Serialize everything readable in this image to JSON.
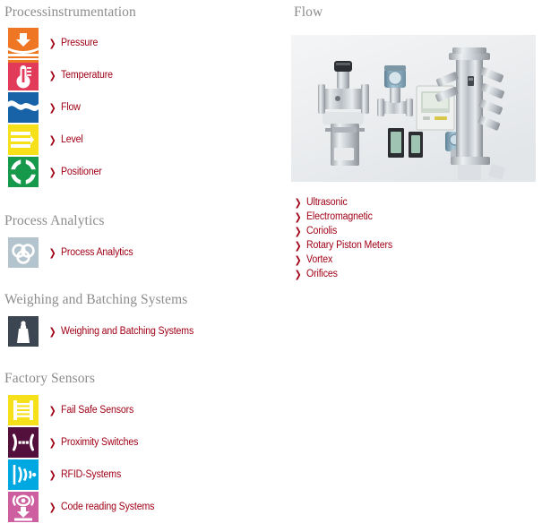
{
  "left_column": {
    "sections": [
      {
        "heading": "Processinstrumentation",
        "items": [
          {
            "label": "Pressure",
            "icon": "pressure-icon",
            "color": "#ef7622"
          },
          {
            "label": "Temperature",
            "icon": "temperature-icon",
            "color": "#e23b5a"
          },
          {
            "label": "Flow",
            "icon": "flow-icon",
            "color": "#1862a8"
          },
          {
            "label": "Level",
            "icon": "level-icon",
            "color": "#f5e01a"
          },
          {
            "label": "Positioner",
            "icon": "positioner-icon",
            "color": "#17994b"
          }
        ]
      },
      {
        "heading": "Process Analytics",
        "items": [
          {
            "label": "Process Analytics",
            "icon": "process-analytics-icon",
            "color": "#b4c4ce"
          }
        ]
      },
      {
        "heading": "Weighing and Batching Systems",
        "items": [
          {
            "label": "Weighing and Batching Systems",
            "icon": "weight-icon",
            "color": "#3c4652"
          }
        ]
      },
      {
        "heading": "Factory Sensors",
        "items": [
          {
            "label": "Fail Safe Sensors",
            "icon": "fail-safe-sensor-icon",
            "color": "#f5e01a"
          },
          {
            "label": "Proximity Switches",
            "icon": "proximity-switch-icon",
            "color": "#54103c"
          },
          {
            "label": "RFID-Systems",
            "icon": "rfid-icon",
            "color": "#00a8e1"
          },
          {
            "label": "Code reading Systems",
            "icon": "code-reading-icon",
            "color": "#cd5fa0"
          }
        ]
      }
    ]
  },
  "right_column": {
    "heading": "Flow",
    "image_alt": "flow-measurement-devices-photo",
    "links": [
      {
        "label": "Ultrasonic"
      },
      {
        "label": "Electromagnetic"
      },
      {
        "label": "Coriolis"
      },
      {
        "label": "Rotary Piston Meters"
      },
      {
        "label": "Vortex"
      },
      {
        "label": "Orifices"
      }
    ]
  },
  "theme": {
    "link_color": "#a00016",
    "heading_color": "#8c8c8c",
    "background": "#ffffff"
  },
  "chevron_glyph": "❯"
}
